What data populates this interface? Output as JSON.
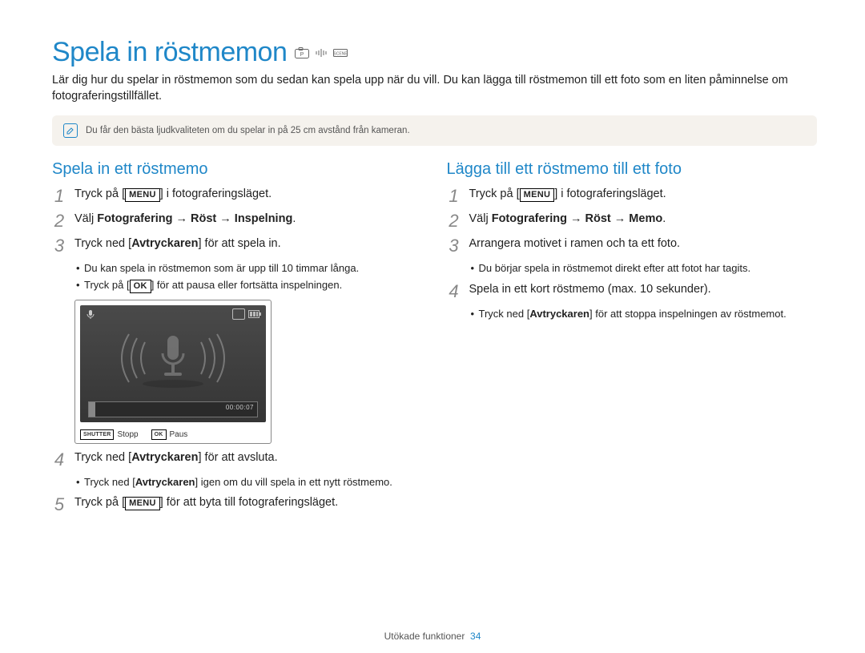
{
  "header": {
    "title": "Spela in röstmemon",
    "intro": "Lär dig hur du spelar in röstmemon som du sedan kan spela upp när du vill. Du kan lägga till röstmemon till ett foto som en liten påminnelse om fotograferingstillfället."
  },
  "note": {
    "text": "Du får den bästa ljudkvaliteten om du spelar in på 25 cm avstånd från kameran."
  },
  "left": {
    "heading": "Spela in ett röstmemo",
    "steps": {
      "1": {
        "pre": "Tryck på [",
        "key": "MENU",
        "post": "] i fotograferingsläget."
      },
      "2": {
        "pre": "Välj ",
        "bold": "Fotografering → Röst → Inspelning",
        "post": "."
      },
      "3": {
        "pre": "Tryck ned [",
        "bold": "Avtryckaren",
        "post": "] för att spela in.",
        "bullets": [
          "Du kan spela in röstmemon som är upp till 10 timmar långa.",
          {
            "pre": "Tryck på [",
            "key": "OK",
            "post": "] för att pausa eller fortsätta inspelningen."
          }
        ]
      },
      "4": {
        "pre": "Tryck ned [",
        "bold": "Avtryckaren",
        "post": "] för att avsluta.",
        "bullets": [
          {
            "pre": "Tryck ned [",
            "bold": "Avtryckaren",
            "post": "] igen om du vill spela in ett nytt röstmemo."
          }
        ]
      },
      "5": {
        "pre": "Tryck på [",
        "key": "MENU",
        "post": "] för att byta till fotograferingsläget."
      }
    },
    "screen": {
      "time": "00:00:07",
      "shutter_key": "SHUTTER",
      "stop": "Stopp",
      "ok_key": "OK",
      "pause": "Paus"
    }
  },
  "right": {
    "heading": "Lägga till ett röstmemo till ett foto",
    "steps": {
      "1": {
        "pre": "Tryck på [",
        "key": "MENU",
        "post": "] i fotograferingsläget."
      },
      "2": {
        "pre": "Välj ",
        "bold": "Fotografering → Röst → Memo",
        "post": "."
      },
      "3": {
        "text": "Arrangera motivet i ramen och ta ett foto.",
        "bullets": [
          "Du börjar spela in röstmemot direkt efter att fotot har tagits."
        ]
      },
      "4": {
        "text": "Spela in ett kort röstmemo (max. 10 sekunder).",
        "bullets": [
          {
            "pre": "Tryck ned [",
            "bold": "Avtryckaren",
            "post": "] för att stoppa inspelningen av röstmemot."
          }
        ]
      }
    }
  },
  "footer": {
    "section": "Utökade funktioner",
    "page": "34"
  }
}
